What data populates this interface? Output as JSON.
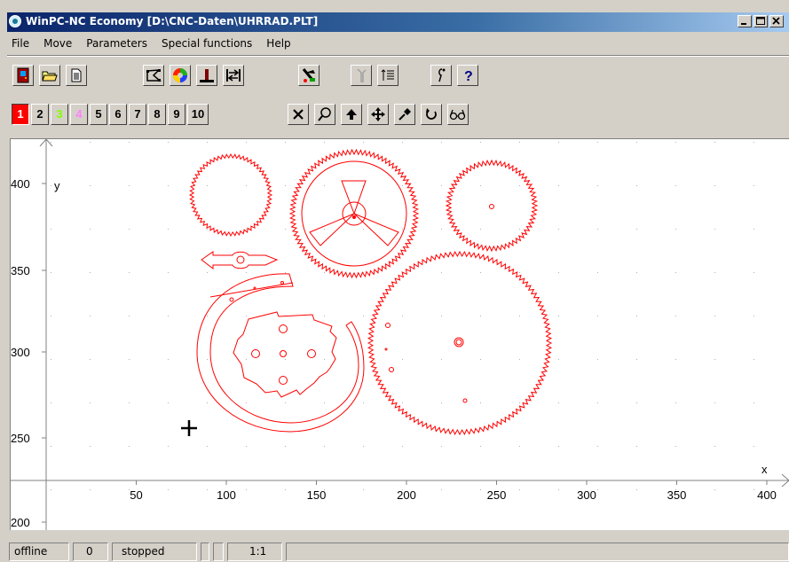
{
  "window": {
    "title": "WinPC-NC Economy [D:\\CNC-Daten\\UHRRAD.PLT]",
    "controls": [
      "minimize",
      "maximize",
      "close"
    ]
  },
  "menu": {
    "items": [
      "File",
      "Move",
      "Parameters",
      "Special functions",
      "Help"
    ]
  },
  "toolbar1": {
    "icons": [
      "exit-icon",
      "open-folder-icon",
      "document-icon",
      "select-icon",
      "color-wheel-icon",
      "origin-icon",
      "reference-run-icon",
      "tools-icon",
      "tool-change-icon",
      "list-icon",
      "info-icon",
      "help-icon"
    ]
  },
  "toolbar2": {
    "layers": [
      {
        "label": "1",
        "color": "#ff0000",
        "active": true
      },
      {
        "label": "2",
        "color": "#000000"
      },
      {
        "label": "3",
        "color": "#80ff00"
      },
      {
        "label": "4",
        "color": "#ff80ff"
      },
      {
        "label": "5",
        "color": "#000000"
      },
      {
        "label": "6",
        "color": "#000000"
      },
      {
        "label": "7",
        "color": "#000000"
      },
      {
        "label": "8",
        "color": "#000000"
      },
      {
        "label": "9",
        "color": "#000000"
      },
      {
        "label": "10",
        "color": "#000000"
      }
    ],
    "view_icons": [
      "cancel-icon",
      "zoom-icon",
      "home-icon",
      "pan-icon",
      "pin-icon",
      "redraw-icon",
      "glasses-icon"
    ]
  },
  "plot": {
    "axis_x_label": "x",
    "axis_y_label": "y",
    "x_ticks": [
      "50",
      "100",
      "150",
      "200",
      "250",
      "300",
      "350",
      "400"
    ],
    "y_ticks": [
      "400",
      "350",
      "300",
      "250",
      "200"
    ],
    "drawing_color": "#ff0000"
  },
  "status": {
    "connection": "offline",
    "counter": "0",
    "state": "stopped",
    "scale": "1:1"
  }
}
